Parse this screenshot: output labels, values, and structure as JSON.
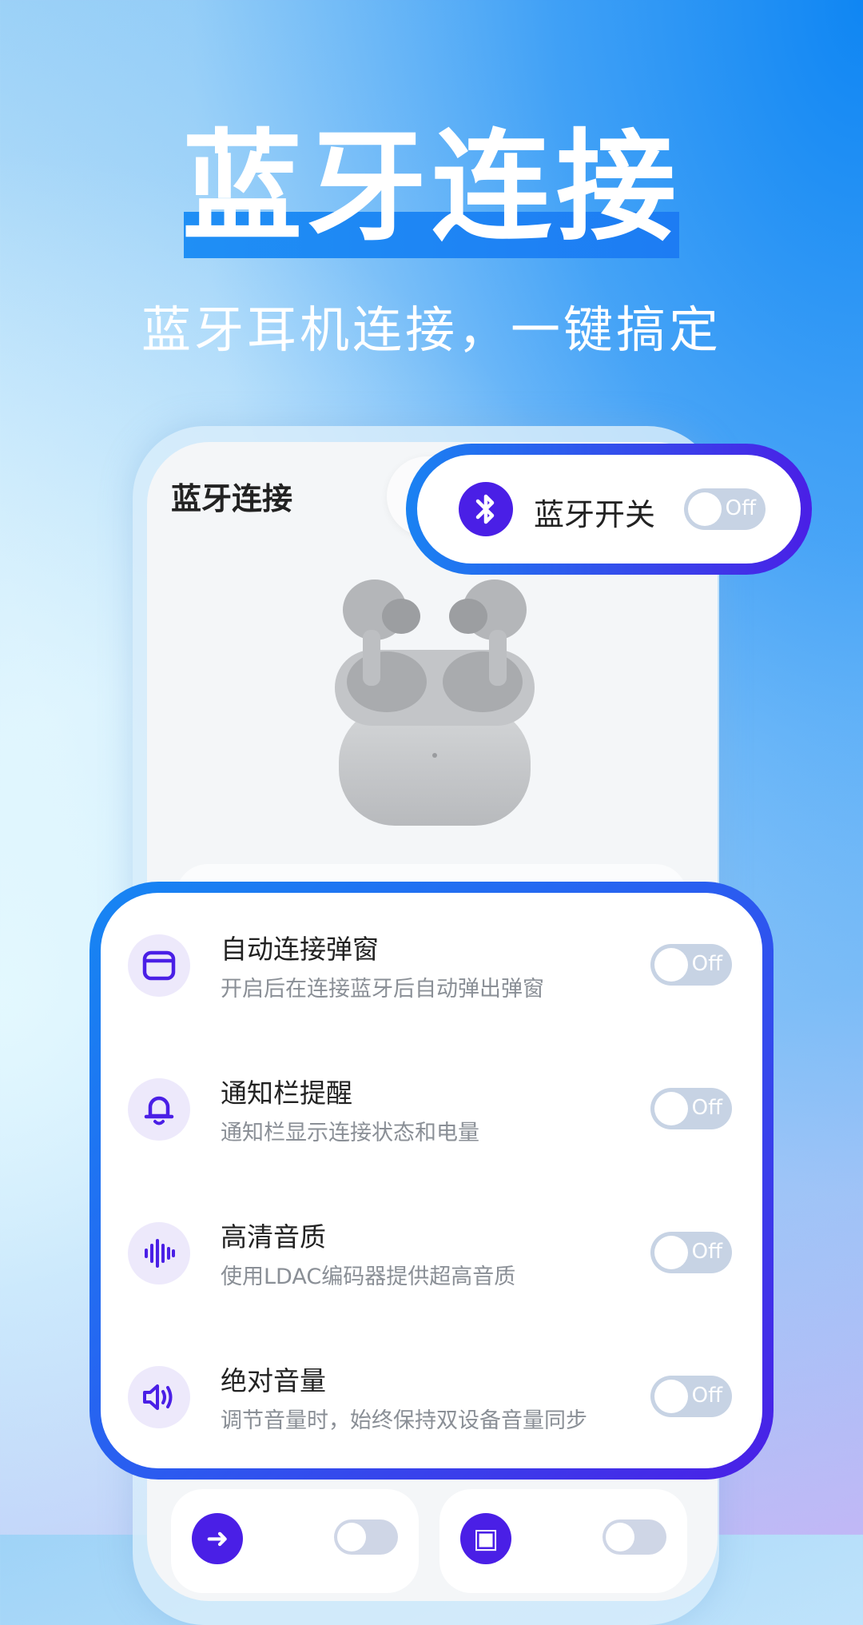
{
  "hero": {
    "title": "蓝牙连接",
    "subtitle": "蓝牙耳机连接，一键搞定"
  },
  "app": {
    "title": "蓝牙连接"
  },
  "bluetooth_card": {
    "icon": "bluetooth-icon",
    "label": "蓝牙开关",
    "toggle_label": "Off"
  },
  "settings": [
    {
      "icon": "popup-window-icon",
      "title": "自动连接弹窗",
      "desc": "开启后在连接蓝牙后自动弹出弹窗",
      "toggle_label": "Off"
    },
    {
      "icon": "bell-icon",
      "title": "通知栏提醒",
      "desc": "通知栏显示连接状态和电量",
      "toggle_label": "Off"
    },
    {
      "icon": "sound-wave-icon",
      "title": "高清音质",
      "desc": "使用LDAC编码器提供超高音质",
      "toggle_label": "Off"
    },
    {
      "icon": "speaker-volume-icon",
      "title": "绝对音量",
      "desc": "调节音量时，始终保持双设备音量同步",
      "toggle_label": "Off"
    }
  ],
  "colors": {
    "accent_blue": "#1a82f2",
    "accent_purple": "#4a1fe6",
    "toggle_off": "#c7d3e4"
  }
}
